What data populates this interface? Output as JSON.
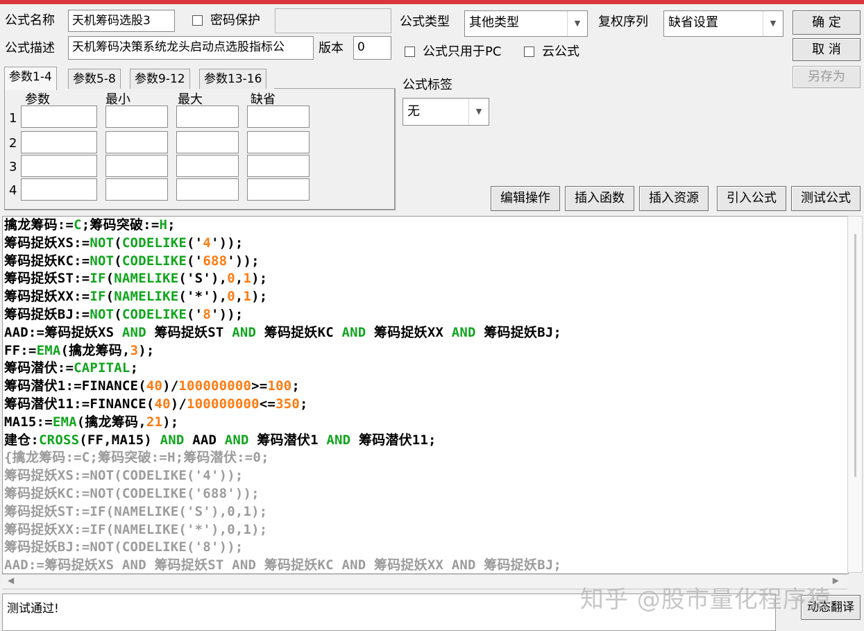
{
  "form": {
    "name_label": "公式名称",
    "name_value": "天机筹码选股3",
    "password_label": "密码保护",
    "password_value": "",
    "desc_label": "公式描述",
    "desc_value": "天机筹码决策系统龙头启动点选股指标公",
    "version_label": "版本",
    "version_value": "0",
    "type_label": "公式类型",
    "type_value": "其他类型",
    "rights_label": "复权序列",
    "rights_value": "缺省设置",
    "pc_only_label": "公式只用于PC",
    "cloud_label": "云公式",
    "tag_label": "公式标签",
    "tag_value": "无"
  },
  "buttons": {
    "ok": "确 定",
    "cancel": "取 消",
    "save_as": "另存为",
    "edit_ops": "编辑操作",
    "insert_func": "插入函数",
    "insert_res": "插入资源",
    "import_formula": "引入公式",
    "test_formula": "测试公式",
    "dynamic_translate": "动态翻译"
  },
  "params": {
    "tabs": [
      "参数1-4",
      "参数5-8",
      "参数9-12",
      "参数13-16"
    ],
    "headers": [
      "参数",
      "最小",
      "最大",
      "缺省"
    ],
    "rows": [
      "1",
      "2",
      "3",
      "4"
    ]
  },
  "code_lines": [
    [
      [
        "t",
        "擒龙筹码:="
      ],
      [
        "k",
        "C"
      ],
      [
        "t",
        ";筹码突破:="
      ],
      [
        "k",
        "H"
      ],
      [
        "t",
        ";"
      ]
    ],
    [
      [
        "t",
        "筹码捉妖XS:="
      ],
      [
        "k",
        "NOT"
      ],
      [
        "t",
        "("
      ],
      [
        "k",
        "CODELIKE"
      ],
      [
        "t",
        "('"
      ],
      [
        "n",
        "4"
      ],
      [
        "t",
        "'));"
      ]
    ],
    [
      [
        "t",
        "筹码捉妖KC:="
      ],
      [
        "k",
        "NOT"
      ],
      [
        "t",
        "("
      ],
      [
        "k",
        "CODELIKE"
      ],
      [
        "t",
        "('"
      ],
      [
        "n",
        "688"
      ],
      [
        "t",
        "'));"
      ]
    ],
    [
      [
        "t",
        "筹码捉妖ST:="
      ],
      [
        "k",
        "IF"
      ],
      [
        "t",
        "("
      ],
      [
        "k",
        "NAMELIKE"
      ],
      [
        "t",
        "('S'),"
      ],
      [
        "n",
        "0"
      ],
      [
        "t",
        ","
      ],
      [
        "n",
        "1"
      ],
      [
        "t",
        ");"
      ]
    ],
    [
      [
        "t",
        "筹码捉妖XX:="
      ],
      [
        "k",
        "IF"
      ],
      [
        "t",
        "("
      ],
      [
        "k",
        "NAMELIKE"
      ],
      [
        "t",
        "('*'),"
      ],
      [
        "n",
        "0"
      ],
      [
        "t",
        ","
      ],
      [
        "n",
        "1"
      ],
      [
        "t",
        ");"
      ]
    ],
    [
      [
        "t",
        "筹码捉妖BJ:="
      ],
      [
        "k",
        "NOT"
      ],
      [
        "t",
        "("
      ],
      [
        "k",
        "CODELIKE"
      ],
      [
        "t",
        "('"
      ],
      [
        "n",
        "8"
      ],
      [
        "t",
        "'));"
      ]
    ],
    [
      [
        "t",
        "AAD:=筹码捉妖XS "
      ],
      [
        "k",
        "AND"
      ],
      [
        "t",
        " 筹码捉妖ST "
      ],
      [
        "k",
        "AND"
      ],
      [
        "t",
        " 筹码捉妖KC "
      ],
      [
        "k",
        "AND"
      ],
      [
        "t",
        " 筹码捉妖XX "
      ],
      [
        "k",
        "AND"
      ],
      [
        "t",
        " 筹码捉妖BJ;"
      ]
    ],
    [
      [
        "t",
        "FF:="
      ],
      [
        "k",
        "EMA"
      ],
      [
        "t",
        "(擒龙筹码,"
      ],
      [
        "n",
        "3"
      ],
      [
        "t",
        ");"
      ]
    ],
    [
      [
        "t",
        "筹码潜伏:="
      ],
      [
        "k",
        "CAPITAL"
      ],
      [
        "t",
        ";"
      ]
    ],
    [
      [
        "t",
        "筹码潜伏1:=FINANCE("
      ],
      [
        "n",
        "40"
      ],
      [
        "t",
        ")/"
      ],
      [
        "n",
        "100000000"
      ],
      [
        "t",
        ">="
      ],
      [
        "n",
        "100"
      ],
      [
        "t",
        ";"
      ]
    ],
    [
      [
        "t",
        "筹码潜伏11:=FINANCE("
      ],
      [
        "n",
        "40"
      ],
      [
        "t",
        ")/"
      ],
      [
        "n",
        "100000000"
      ],
      [
        "t",
        "<="
      ],
      [
        "n",
        "350"
      ],
      [
        "t",
        ";"
      ]
    ],
    [
      [
        "t",
        "MA15:="
      ],
      [
        "k",
        "EMA"
      ],
      [
        "t",
        "(擒龙筹码,"
      ],
      [
        "n",
        "21"
      ],
      [
        "t",
        ");"
      ]
    ],
    [
      [
        "t",
        "建仓:"
      ],
      [
        "k",
        "CROSS"
      ],
      [
        "t",
        "(FF,MA15) "
      ],
      [
        "k",
        "AND"
      ],
      [
        "t",
        " AAD "
      ],
      [
        "k",
        "AND"
      ],
      [
        "t",
        " 筹码潜伏1 "
      ],
      [
        "k",
        "AND"
      ],
      [
        "t",
        " 筹码潜伏11;"
      ]
    ],
    [
      [
        "c",
        "{擒龙筹码:=C;筹码突破:=H;筹码潜伏:=0;"
      ]
    ],
    [
      [
        "c",
        "筹码捉妖XS:=NOT(CODELIKE('4'));"
      ]
    ],
    [
      [
        "c",
        "筹码捉妖KC:=NOT(CODELIKE('688'));"
      ]
    ],
    [
      [
        "c",
        "筹码捉妖ST:=IF(NAMELIKE('S'),0,1);"
      ]
    ],
    [
      [
        "c",
        "筹码捉妖XX:=IF(NAMELIKE('*'),0,1);"
      ]
    ],
    [
      [
        "c",
        "筹码捉妖BJ:=NOT(CODELIKE('8'));"
      ]
    ],
    [
      [
        "c",
        "AAD:=筹码捉妖XS AND 筹码捉妖ST AND 筹码捉妖KC AND 筹码捉妖XX AND 筹码捉妖BJ;"
      ]
    ]
  ],
  "status_text": "测试通过!",
  "watermark": "知乎 @股市量化程序猿",
  "colors": {
    "keyword": "#11a51e",
    "number": "#ff7a10",
    "comment": "#9c9c9c",
    "title_bar": "#d9363e"
  }
}
